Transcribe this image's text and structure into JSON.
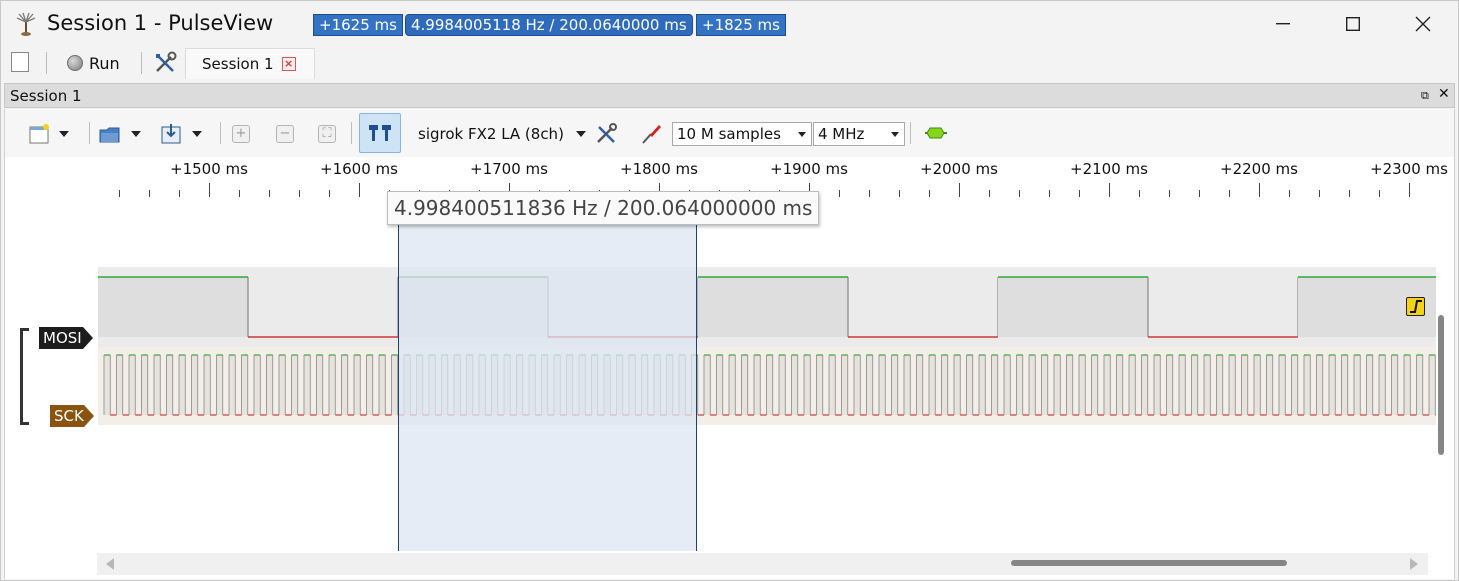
{
  "window": {
    "title": "Session 1 - PulseView"
  },
  "main_toolbar": {
    "run_label": "Run",
    "session_tab_label": "Session 1"
  },
  "session_header": {
    "title": "Session 1"
  },
  "session_toolbar": {
    "device": "sigrok FX2 LA (8ch)",
    "sample_count": "10 M samples",
    "sample_rate": "4 MHz"
  },
  "ruler": {
    "labels": [
      "+1500 ms",
      "+1600 ms",
      "+1700 ms",
      "+1800 ms",
      "+1900 ms",
      "+2000 ms",
      "+2100 ms",
      "+2200 ms",
      "+2300 ms"
    ]
  },
  "cursors": {
    "cursor1": "+1625 ms",
    "cursor2": "+1825 ms",
    "diff_label": "4.9984005118 Hz / 200.0640000 ms",
    "tooltip": "4.998400511836 Hz / 200.064000000 ms"
  },
  "channels": [
    {
      "name": "MOSI",
      "color": "#1c1c1c"
    },
    {
      "name": "SCK",
      "color": "#8a5410"
    }
  ],
  "colors": {
    "signal_high": "#0c9d12",
    "signal_low": "#c41414",
    "selection_fill": "#dce6f2",
    "cursor_flag": "#3472c4"
  }
}
